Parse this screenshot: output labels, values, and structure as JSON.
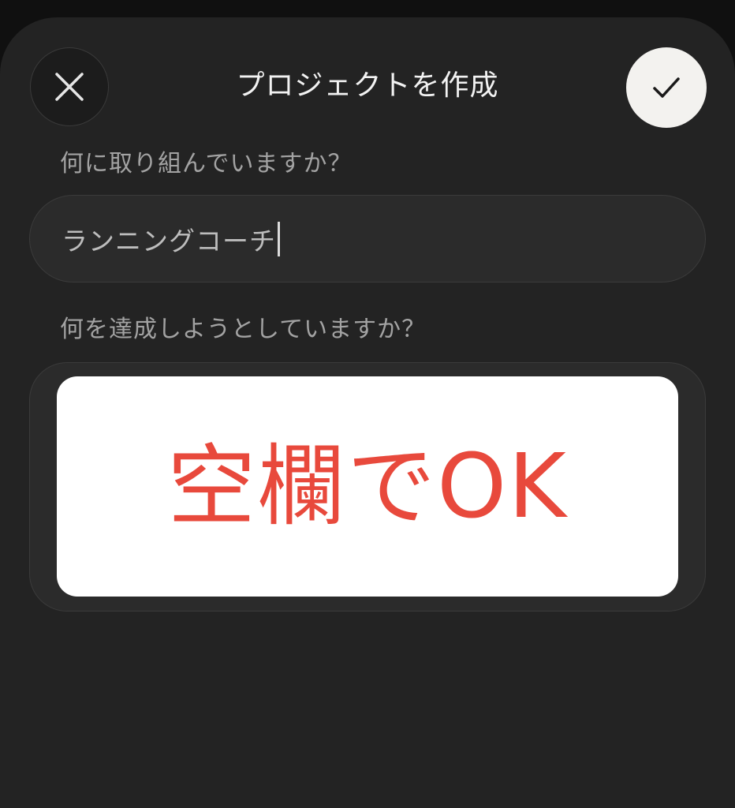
{
  "header": {
    "title": "プロジェクトを作成",
    "close_icon": "close-icon",
    "confirm_icon": "checkmark-icon"
  },
  "form": {
    "question_1": "何に取り組んでいますか？",
    "field_1_value": "ランニングコーチ",
    "question_2": "何を達成しようとしていますか？",
    "field_2_value": ""
  },
  "overlay": {
    "text": "空欄でOK",
    "color": "#e8493c"
  },
  "colors": {
    "sheet_background": "#232323",
    "field_background": "#2b2b2b",
    "confirm_button": "#f3f2ef"
  }
}
